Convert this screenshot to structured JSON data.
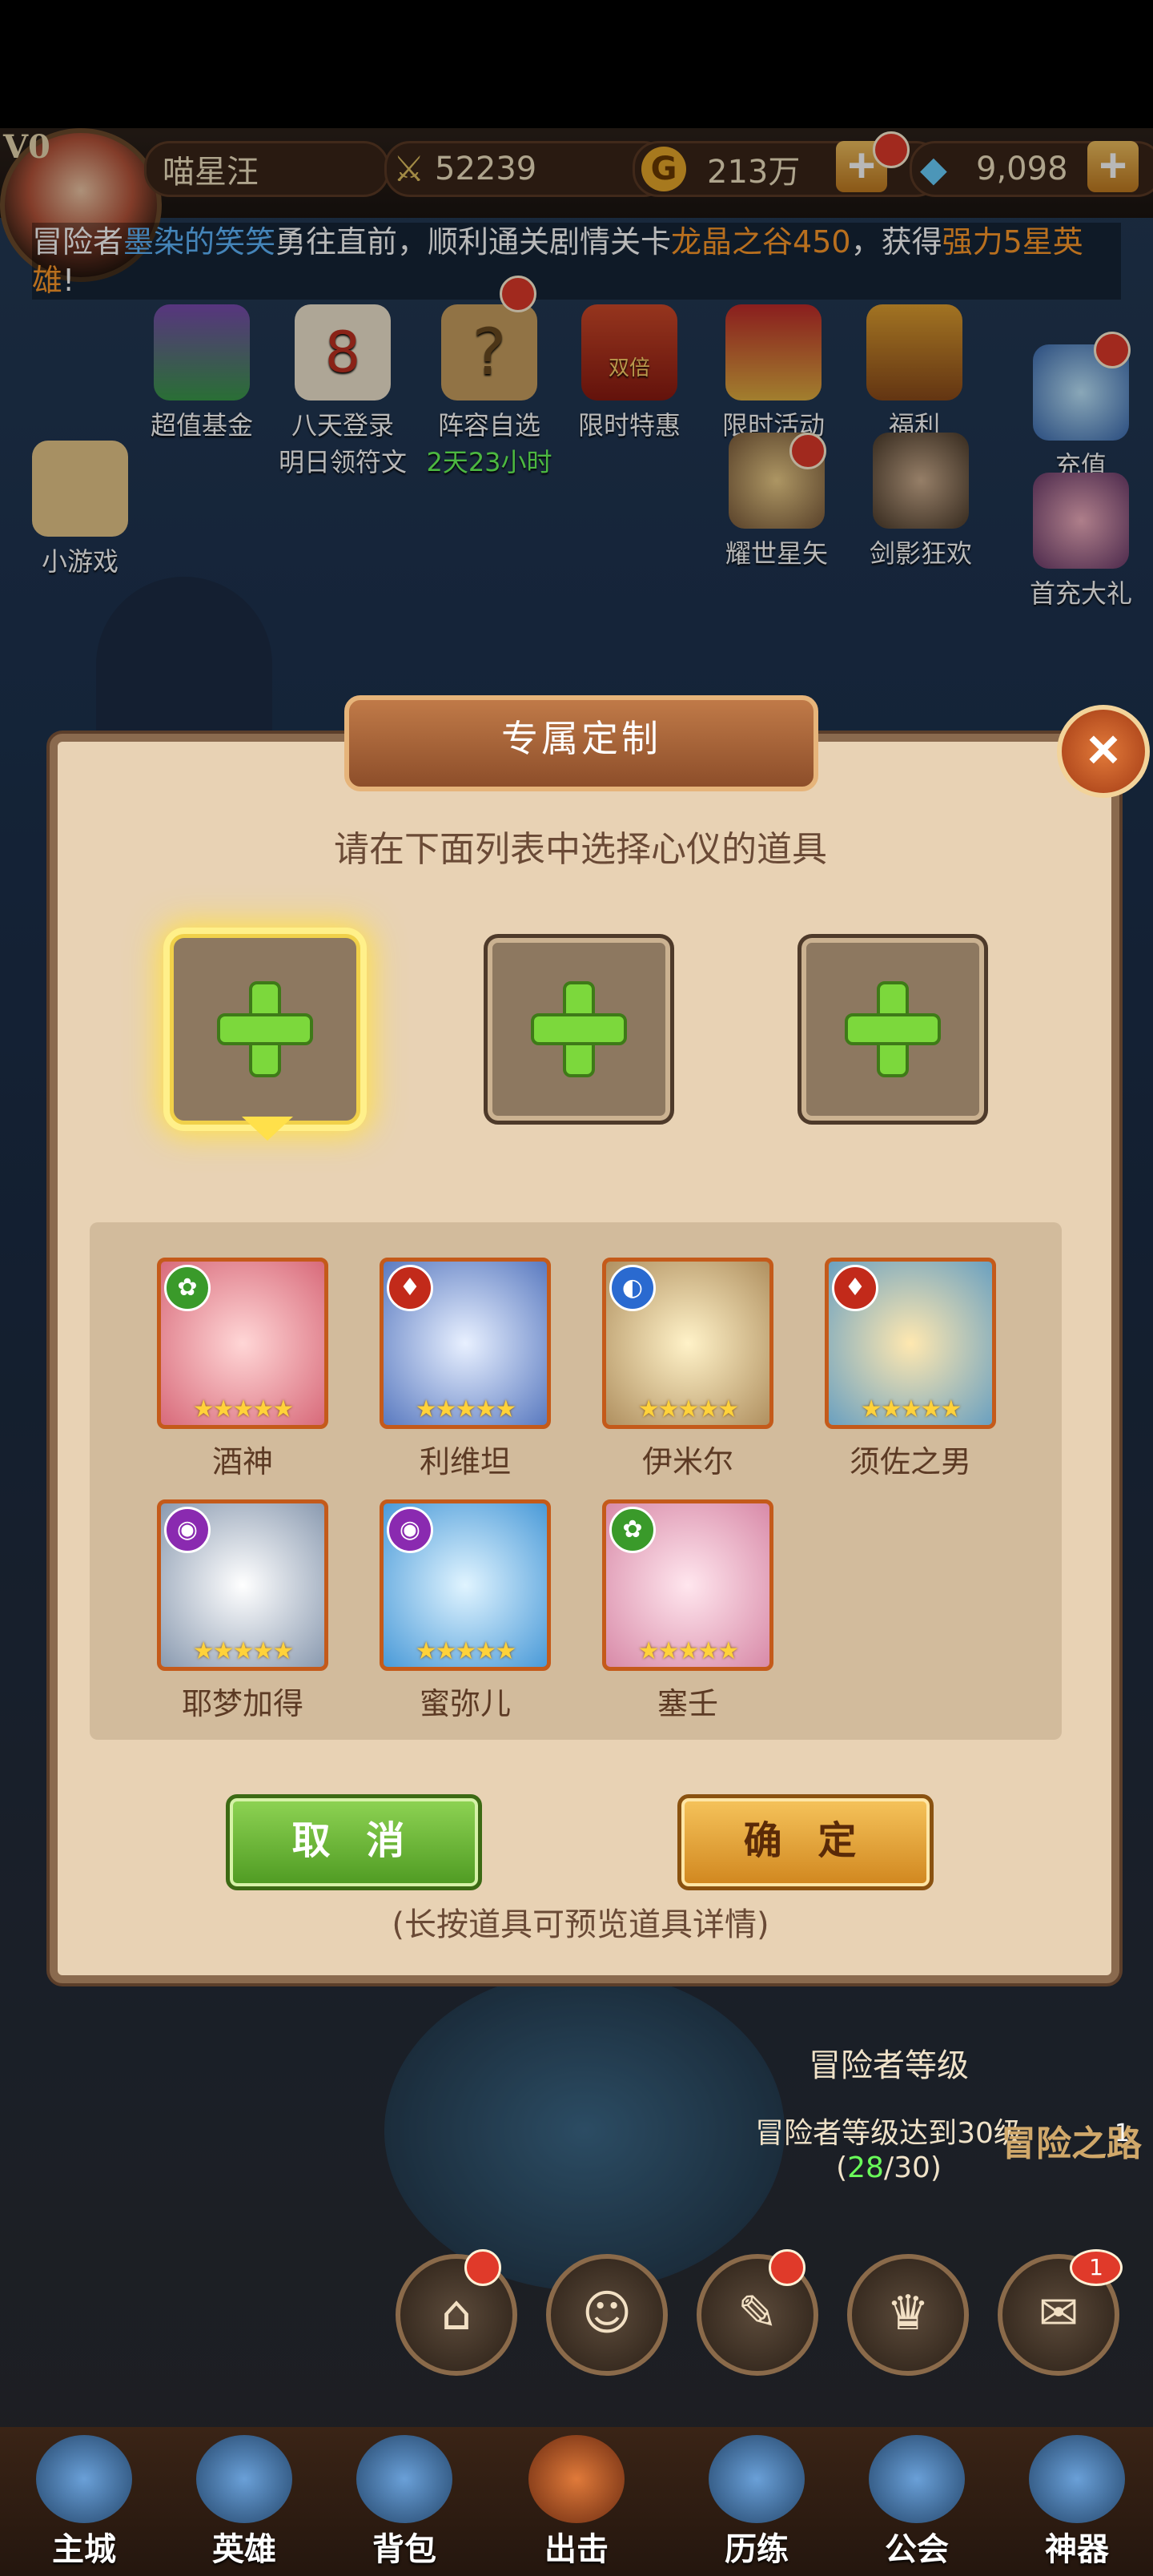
{
  "header": {
    "vip": "V0",
    "player_name": "喵星汪",
    "power": "52239",
    "gold": "213万",
    "diamonds": "9,098",
    "gold_icon": "G"
  },
  "marquee": {
    "prefix": "冒险者",
    "player": "墨染的笑笑",
    "middle": "勇往直前，顺利通关剧情关卡",
    "stage": "龙晶之谷450",
    "suffix1": "，获得",
    "reward": "强力5星英雄",
    "suffix2": "!"
  },
  "activities": [
    {
      "label": "超值基金"
    },
    {
      "label": "八天登录"
    },
    {
      "label": "阵容自选"
    },
    {
      "label": "限时特惠"
    },
    {
      "label": "限时活动"
    },
    {
      "label": "福利"
    },
    {
      "label": "充值"
    }
  ],
  "activity_subtext": {
    "login": "明日领符文",
    "timer": "2天23小时",
    "badge_8": "8",
    "double": "双倍"
  },
  "side_icons": {
    "minigame": "小游戏",
    "hero1": "耀世星矢",
    "hero2": "剑影狂欢",
    "first_recharge": "首充大礼"
  },
  "dialog": {
    "title": "专属定制",
    "subtitle": "请在下面列表中选择心仪的道具",
    "cancel": "取 消",
    "confirm": "确 定",
    "hint": "(长按道具可预览道具详情)"
  },
  "heroes": [
    {
      "name": "酒神",
      "element": "nature",
      "color": "#3a9a2a",
      "stars": "★★★★★"
    },
    {
      "name": "利维坦",
      "element": "fire",
      "color": "#c22a1a",
      "stars": "★★★★★"
    },
    {
      "name": "伊米尔",
      "element": "water",
      "color": "#2a6ad0",
      "stars": "★★★★★"
    },
    {
      "name": "须佐之男",
      "element": "fire",
      "color": "#c22a1a",
      "stars": "★★★★★"
    },
    {
      "name": "耶梦加得",
      "element": "dark",
      "color": "#8a2ab0",
      "stars": "★★★★★"
    },
    {
      "name": "蜜弥儿",
      "element": "dark",
      "color": "#8a2ab0",
      "stars": "★★★★★"
    },
    {
      "name": "塞壬",
      "element": "nature",
      "color": "#3a9a2a",
      "stars": "★★★★★"
    }
  ],
  "quest": {
    "title": "冒险者等级",
    "desc": "冒险者等级达到30级",
    "progress_open": "(",
    "progress_current": "28",
    "progress_rest": "/30)",
    "path": "冒险之路",
    "count": "1"
  },
  "nav": [
    {
      "label": "主城"
    },
    {
      "label": "英雄"
    },
    {
      "label": "背包"
    },
    {
      "label": "出击"
    },
    {
      "label": "历练"
    },
    {
      "label": "公会"
    },
    {
      "label": "神器"
    }
  ],
  "mail_badge": "1"
}
